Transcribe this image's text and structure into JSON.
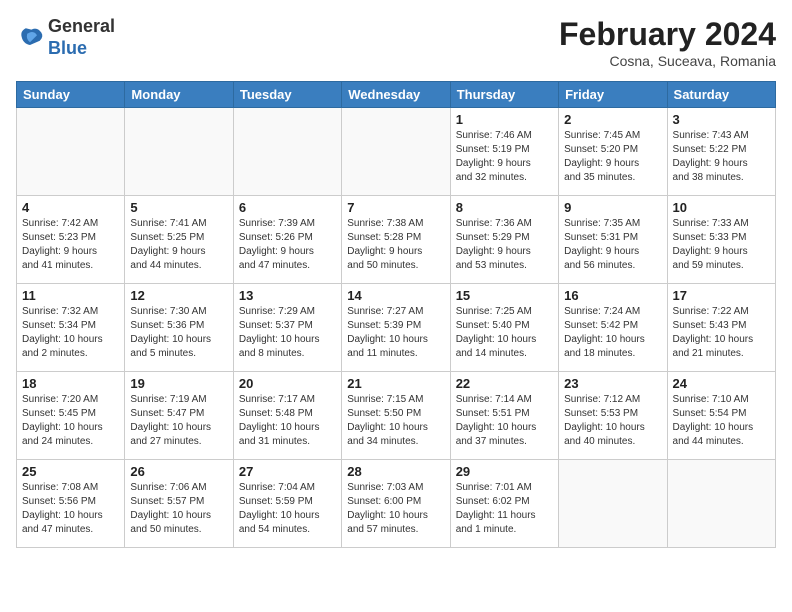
{
  "logo": {
    "general": "General",
    "blue": "Blue"
  },
  "header": {
    "month_year": "February 2024",
    "location": "Cosna, Suceava, Romania"
  },
  "days_of_week": [
    "Sunday",
    "Monday",
    "Tuesday",
    "Wednesday",
    "Thursday",
    "Friday",
    "Saturday"
  ],
  "weeks": [
    [
      {
        "day": "",
        "detail": ""
      },
      {
        "day": "",
        "detail": ""
      },
      {
        "day": "",
        "detail": ""
      },
      {
        "day": "",
        "detail": ""
      },
      {
        "day": "1",
        "detail": "Sunrise: 7:46 AM\nSunset: 5:19 PM\nDaylight: 9 hours\nand 32 minutes."
      },
      {
        "day": "2",
        "detail": "Sunrise: 7:45 AM\nSunset: 5:20 PM\nDaylight: 9 hours\nand 35 minutes."
      },
      {
        "day": "3",
        "detail": "Sunrise: 7:43 AM\nSunset: 5:22 PM\nDaylight: 9 hours\nand 38 minutes."
      }
    ],
    [
      {
        "day": "4",
        "detail": "Sunrise: 7:42 AM\nSunset: 5:23 PM\nDaylight: 9 hours\nand 41 minutes."
      },
      {
        "day": "5",
        "detail": "Sunrise: 7:41 AM\nSunset: 5:25 PM\nDaylight: 9 hours\nand 44 minutes."
      },
      {
        "day": "6",
        "detail": "Sunrise: 7:39 AM\nSunset: 5:26 PM\nDaylight: 9 hours\nand 47 minutes."
      },
      {
        "day": "7",
        "detail": "Sunrise: 7:38 AM\nSunset: 5:28 PM\nDaylight: 9 hours\nand 50 minutes."
      },
      {
        "day": "8",
        "detail": "Sunrise: 7:36 AM\nSunset: 5:29 PM\nDaylight: 9 hours\nand 53 minutes."
      },
      {
        "day": "9",
        "detail": "Sunrise: 7:35 AM\nSunset: 5:31 PM\nDaylight: 9 hours\nand 56 minutes."
      },
      {
        "day": "10",
        "detail": "Sunrise: 7:33 AM\nSunset: 5:33 PM\nDaylight: 9 hours\nand 59 minutes."
      }
    ],
    [
      {
        "day": "11",
        "detail": "Sunrise: 7:32 AM\nSunset: 5:34 PM\nDaylight: 10 hours\nand 2 minutes."
      },
      {
        "day": "12",
        "detail": "Sunrise: 7:30 AM\nSunset: 5:36 PM\nDaylight: 10 hours\nand 5 minutes."
      },
      {
        "day": "13",
        "detail": "Sunrise: 7:29 AM\nSunset: 5:37 PM\nDaylight: 10 hours\nand 8 minutes."
      },
      {
        "day": "14",
        "detail": "Sunrise: 7:27 AM\nSunset: 5:39 PM\nDaylight: 10 hours\nand 11 minutes."
      },
      {
        "day": "15",
        "detail": "Sunrise: 7:25 AM\nSunset: 5:40 PM\nDaylight: 10 hours\nand 14 minutes."
      },
      {
        "day": "16",
        "detail": "Sunrise: 7:24 AM\nSunset: 5:42 PM\nDaylight: 10 hours\nand 18 minutes."
      },
      {
        "day": "17",
        "detail": "Sunrise: 7:22 AM\nSunset: 5:43 PM\nDaylight: 10 hours\nand 21 minutes."
      }
    ],
    [
      {
        "day": "18",
        "detail": "Sunrise: 7:20 AM\nSunset: 5:45 PM\nDaylight: 10 hours\nand 24 minutes."
      },
      {
        "day": "19",
        "detail": "Sunrise: 7:19 AM\nSunset: 5:47 PM\nDaylight: 10 hours\nand 27 minutes."
      },
      {
        "day": "20",
        "detail": "Sunrise: 7:17 AM\nSunset: 5:48 PM\nDaylight: 10 hours\nand 31 minutes."
      },
      {
        "day": "21",
        "detail": "Sunrise: 7:15 AM\nSunset: 5:50 PM\nDaylight: 10 hours\nand 34 minutes."
      },
      {
        "day": "22",
        "detail": "Sunrise: 7:14 AM\nSunset: 5:51 PM\nDaylight: 10 hours\nand 37 minutes."
      },
      {
        "day": "23",
        "detail": "Sunrise: 7:12 AM\nSunset: 5:53 PM\nDaylight: 10 hours\nand 40 minutes."
      },
      {
        "day": "24",
        "detail": "Sunrise: 7:10 AM\nSunset: 5:54 PM\nDaylight: 10 hours\nand 44 minutes."
      }
    ],
    [
      {
        "day": "25",
        "detail": "Sunrise: 7:08 AM\nSunset: 5:56 PM\nDaylight: 10 hours\nand 47 minutes."
      },
      {
        "day": "26",
        "detail": "Sunrise: 7:06 AM\nSunset: 5:57 PM\nDaylight: 10 hours\nand 50 minutes."
      },
      {
        "day": "27",
        "detail": "Sunrise: 7:04 AM\nSunset: 5:59 PM\nDaylight: 10 hours\nand 54 minutes."
      },
      {
        "day": "28",
        "detail": "Sunrise: 7:03 AM\nSunset: 6:00 PM\nDaylight: 10 hours\nand 57 minutes."
      },
      {
        "day": "29",
        "detail": "Sunrise: 7:01 AM\nSunset: 6:02 PM\nDaylight: 11 hours\nand 1 minute."
      },
      {
        "day": "",
        "detail": ""
      },
      {
        "day": "",
        "detail": ""
      }
    ]
  ]
}
